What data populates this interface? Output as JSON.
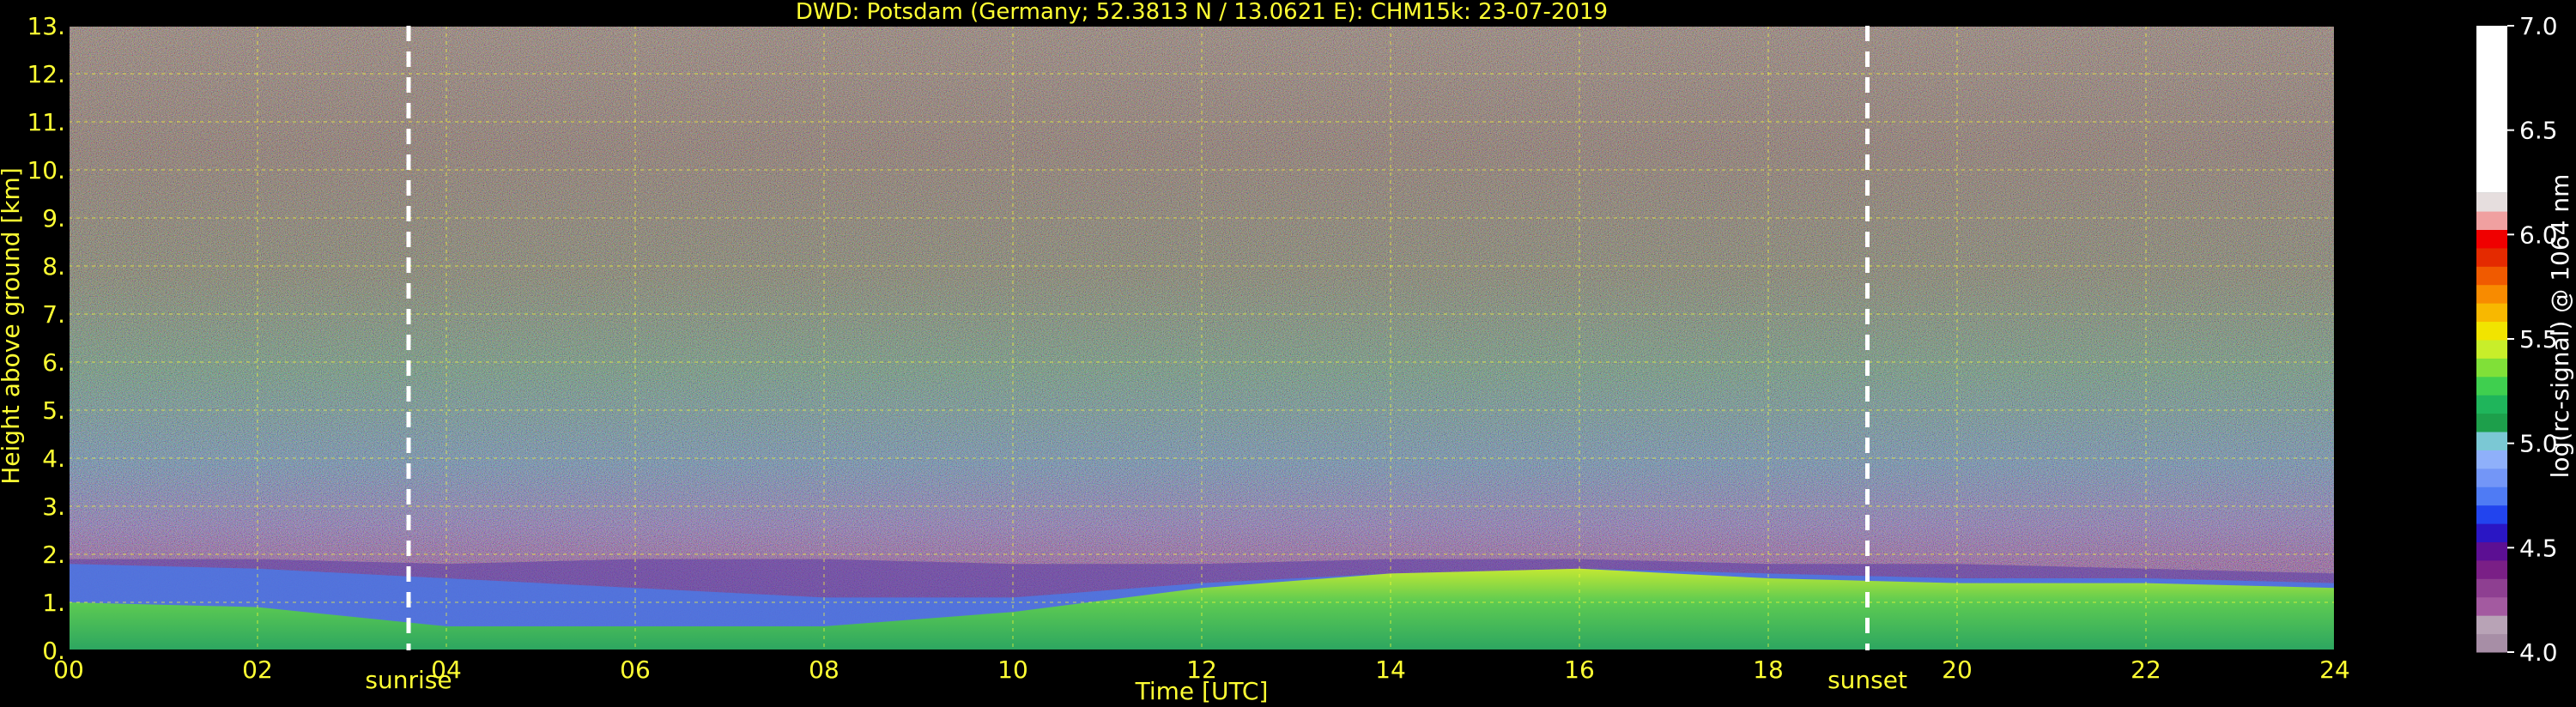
{
  "chart_data": {
    "type": "heatmap",
    "title": "DWD: Potsdam (Germany; 52.3813 N / 13.0621 E):    CHM15k: 23-07-2019",
    "xlabel": "Time [UTC]",
    "ylabel": "Height above ground [km]",
    "xlim": [
      0,
      24
    ],
    "ylim": [
      0,
      13
    ],
    "xticks": [
      "00",
      "02",
      "04",
      "06",
      "08",
      "10",
      "12",
      "14",
      "16",
      "18",
      "20",
      "22",
      "24"
    ],
    "yticks": [
      "0.",
      "1.",
      "2.",
      "3.",
      "4.",
      "5.",
      "6.",
      "7.",
      "8.",
      "9.",
      "10.",
      "11.",
      "12.",
      "13."
    ],
    "grid": true,
    "sunrise": {
      "time": 3.6,
      "label": "sunrise"
    },
    "sunset": {
      "time": 19.05,
      "label": "sunset"
    },
    "colorbar": {
      "label": "log(rc-signal) @ 1064 nm",
      "min": 4.0,
      "max": 7.0,
      "ticks": [
        "4.0",
        "4.5",
        "5.0",
        "5.5",
        "6.0",
        "6.5",
        "7.0"
      ],
      "colors": [
        "#a78ea6",
        "#b8a3b6",
        "#a35aa0",
        "#8e3f91",
        "#7a1f86",
        "#5c0f93",
        "#2a16c4",
        "#2244ee",
        "#4f7bf4",
        "#7396f7",
        "#8fb0fa",
        "#7bc8d4",
        "#1d9f4b",
        "#1fb55b",
        "#3fcf4f",
        "#80e038",
        "#c8ee2a",
        "#f1e400",
        "#f8b800",
        "#f88b00",
        "#f05a00",
        "#e42a00",
        "#f00000",
        "#f0a0a0",
        "#e6dede",
        "#ffffff"
      ]
    },
    "layers": [
      {
        "time": 0.0,
        "top_blh": 1.0,
        "top_residual": 1.8,
        "top_aerosol": 1.9
      },
      {
        "time": 2.0,
        "top_blh": 0.9,
        "top_residual": 1.7,
        "top_aerosol": 1.9
      },
      {
        "time": 4.0,
        "top_blh": 0.5,
        "top_residual": 1.5,
        "top_aerosol": 1.8
      },
      {
        "time": 6.0,
        "top_blh": 0.5,
        "top_residual": 1.3,
        "top_aerosol": 1.9
      },
      {
        "time": 8.0,
        "top_blh": 0.5,
        "top_residual": 1.1,
        "top_aerosol": 1.9
      },
      {
        "time": 10.0,
        "top_blh": 0.8,
        "top_residual": 1.1,
        "top_aerosol": 1.8
      },
      {
        "time": 12.0,
        "top_blh": 1.3,
        "top_residual": 1.4,
        "top_aerosol": 1.8
      },
      {
        "time": 14.0,
        "top_blh": 1.6,
        "top_residual": 1.6,
        "top_aerosol": 1.9
      },
      {
        "time": 16.0,
        "top_blh": 1.7,
        "top_residual": 1.7,
        "top_aerosol": 1.9
      },
      {
        "time": 18.0,
        "top_blh": 1.5,
        "top_residual": 1.6,
        "top_aerosol": 1.8
      },
      {
        "time": 20.0,
        "top_blh": 1.4,
        "top_residual": 1.5,
        "top_aerosol": 1.8
      },
      {
        "time": 22.0,
        "top_blh": 1.4,
        "top_residual": 1.5,
        "top_aerosol": 1.7
      },
      {
        "time": 24.0,
        "top_blh": 1.3,
        "top_residual": 1.4,
        "top_aerosol": 1.6
      }
    ]
  }
}
